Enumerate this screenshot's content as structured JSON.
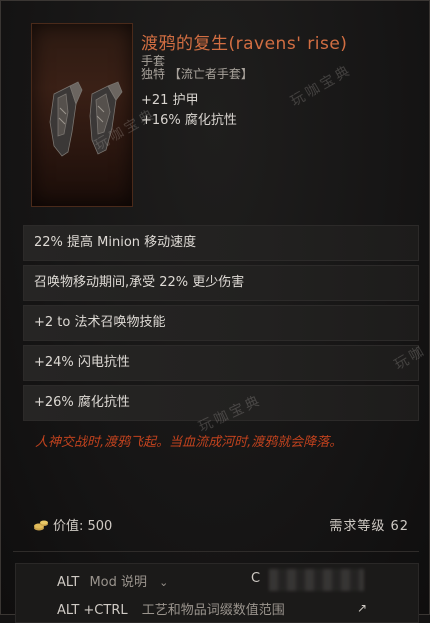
{
  "item": {
    "name": "渡鸦的复生(ravens' rise)",
    "type": "手套",
    "rarity": "独特 【流亡者手套】",
    "implicits": [
      "+21 护甲",
      "+16% 腐化抗性"
    ]
  },
  "affixes": [
    "22% 提高 Minion 移动速度",
    "召唤物移动期间,承受 22% 更少伤害",
    "+2 to 法术召唤物技能",
    "+24% 闪电抗性",
    "+26% 腐化抗性"
  ],
  "lore": "人神交战时,渡鸦飞起。当血流成河时,渡鸦就会降落。",
  "footer": {
    "value_label": "价值: 500",
    "requirement_label": "需求等级  62"
  },
  "hints": {
    "mod_key": "ALT",
    "mod_label": "Mod 说明",
    "ctrl_key": "C",
    "craft_key": "ALT +CTRL",
    "craft_label": "工艺和物品词缀数值范围"
  },
  "watermark": {
    "text_a": "玩咖宝典",
    "text_b": "玩咖"
  },
  "colors": {
    "title": "#d26e42",
    "lore": "#c0421e"
  },
  "icons": {
    "coin": "coin-stack-icon",
    "gloves": "gloves-icon",
    "chevron": "chevron-down-icon",
    "arrow": "arrow-icon"
  }
}
